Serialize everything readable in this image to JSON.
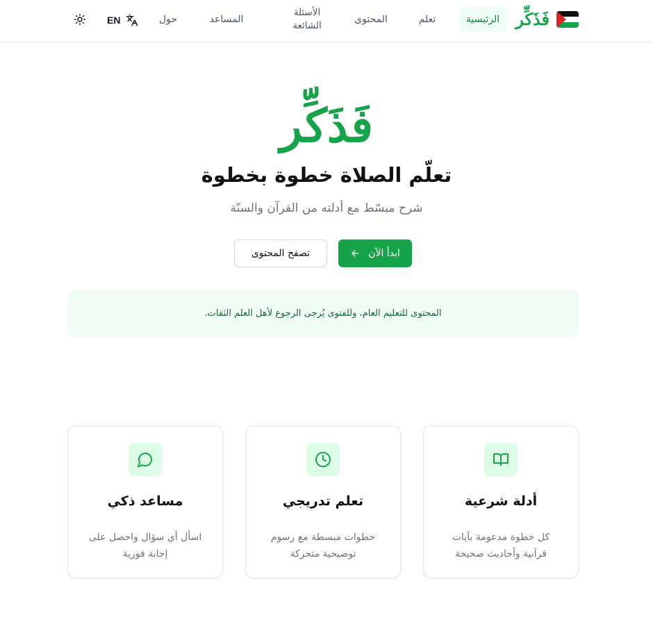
{
  "header": {
    "brand": "فَذَكِّر",
    "nav": [
      {
        "label": "الرئيسية",
        "active": true
      },
      {
        "label": "تعلم",
        "active": false
      },
      {
        "label": "المحتوى",
        "active": false
      },
      {
        "label": "الأسئلة الشائعة",
        "active": false
      },
      {
        "label": "المساعد",
        "active": false
      },
      {
        "label": "حول",
        "active": false
      }
    ],
    "language_label": "EN",
    "language_icon": "translate-icon",
    "theme_icon": "sun-icon"
  },
  "hero": {
    "logo_text": "فَذَكِّر",
    "title": "تعلّم الصلاة خطوة بخطوة",
    "subtitle": "شرح مبسّط مع أدلته من القرآن والسنّة",
    "primary_button": "ابدأ الآن",
    "primary_button_icon": "arrow-left-icon",
    "secondary_button": "تصفح المحتوى",
    "notice": "المحتوى للتعليم العام، وللفتوى يُرجى الرجوع لأهل العلم الثقات."
  },
  "features": [
    {
      "icon": "book-open-icon",
      "title": "أدلة شرعية",
      "description": "كل خطوة مدعومة بآيات قرآنية وأحاديث صحيحة"
    },
    {
      "icon": "clock-icon",
      "title": "تعلم تدريجي",
      "description": "خطوات مبسطة مع رسوم توضيحية متحركة"
    },
    {
      "icon": "chat-bubble-icon",
      "title": "مساعد ذكي",
      "description": "اسأل أي سؤال واحصل على إجابة فورية"
    }
  ],
  "colors": {
    "brand_green": "#16a34a",
    "active_nav_bg": "#ecfdf3",
    "notice_bg": "#f0fdf4",
    "icon_bg": "#dcfce7"
  }
}
